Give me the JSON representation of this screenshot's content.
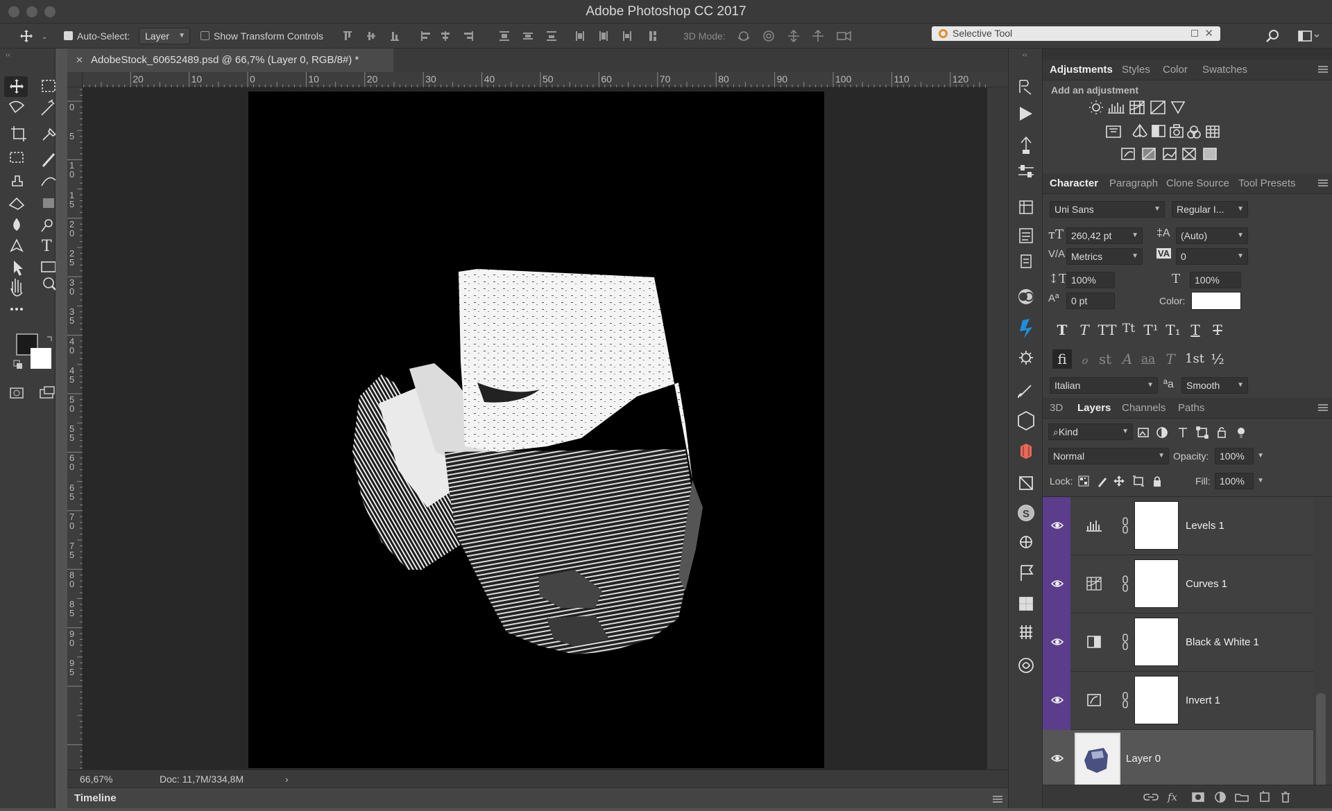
{
  "app": {
    "title": "Adobe Photoshop CC 2017"
  },
  "options_bar": {
    "auto_select_label": "Auto-Select:",
    "auto_select_value": "Layer",
    "show_transform_label": "Show Transform Controls",
    "mode_3d_label": "3D Mode:",
    "selective_tool_label": "Selective Tool"
  },
  "document": {
    "tab_title": "AdobeStock_60652489.psd @ 66,7% (Layer 0, RGB/8#) *",
    "zoom": "66,67%",
    "doc_info": "Doc: 11,7M/334,8M"
  },
  "rulers": {
    "h_labels": [
      "20",
      "10",
      "0",
      "10",
      "20",
      "30",
      "40",
      "50",
      "60",
      "70",
      "80",
      "90",
      "100",
      "110",
      "120"
    ],
    "v_labels": [
      "0",
      "5",
      "1\n0",
      "1\n5",
      "2\n0",
      "2\n5",
      "3\n0",
      "3\n5",
      "4\n0",
      "4\n5",
      "5\n0",
      "5\n5",
      "6\n0",
      "6\n5",
      "7\n0",
      "7\n5",
      "8\n0",
      "8\n5",
      "9\n0",
      "9\n5"
    ]
  },
  "timeline": {
    "label": "Timeline"
  },
  "adjustments_panel": {
    "tabs": [
      "Adjustments",
      "Styles",
      "Color",
      "Swatches"
    ],
    "heading": "Add an adjustment"
  },
  "character_panel": {
    "tabs": [
      "Character",
      "Paragraph",
      "Clone Source",
      "Tool Presets"
    ],
    "font_family": "Uni Sans",
    "font_style": "Regular I...",
    "font_size": "260,42 pt",
    "leading": "(Auto)",
    "kerning": "Metrics",
    "tracking": "0",
    "vertical_scale": "100%",
    "horizontal_scale": "100%",
    "baseline_shift": "0 pt",
    "color_label": "Color:",
    "color_swatch": "#ffffff",
    "language": "Italian",
    "aa_label": "a",
    "antialias": "Smooth",
    "type_buttons": [
      "T",
      "T",
      "TT",
      "Tt",
      "T¹",
      "T₁",
      "T",
      "T"
    ],
    "opentype_buttons": [
      "fi",
      "ℴ",
      "st",
      "A",
      "aa",
      "T",
      "1st",
      "½"
    ]
  },
  "layers_panel": {
    "tabs": [
      "3D",
      "Layers",
      "Channels",
      "Paths"
    ],
    "filter_kind": "Kind",
    "blend_mode": "Normal",
    "opacity_label": "Opacity:",
    "opacity_value": "100%",
    "lock_label": "Lock:",
    "fill_label": "Fill:",
    "fill_value": "100%",
    "layers": [
      {
        "name": "Levels 1",
        "type_icon": "levels-icon"
      },
      {
        "name": "Curves 1",
        "type_icon": "curves-icon"
      },
      {
        "name": "Black & White 1",
        "type_icon": "black-white-icon"
      },
      {
        "name": "Invert 1",
        "type_icon": "invert-icon"
      }
    ],
    "base_layer": {
      "name": "Layer 0"
    }
  },
  "colors": {
    "layer_highlight": "#5c3d8c",
    "foreground": "#1a1a1a",
    "background": "#ffffff"
  }
}
